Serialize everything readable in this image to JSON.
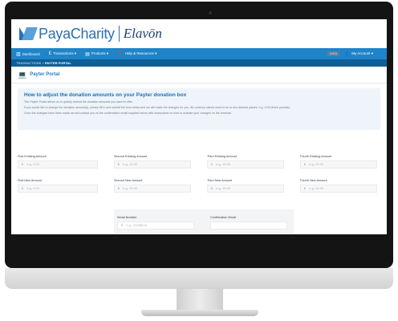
{
  "brand": {
    "paya": "PayaCharity",
    "elavon": "Elavōn"
  },
  "nav": {
    "items": [
      {
        "icon": "▥",
        "label": "Dashboard"
      },
      {
        "icon": "£",
        "label": "Transactions ▾"
      },
      {
        "icon": "▤",
        "label": "Products ▾"
      },
      {
        "icon": "❓",
        "label": "Help & Resources ▾"
      }
    ],
    "badge": "1.0.0",
    "account": "My Account ▾"
  },
  "breadcrumb": {
    "root": "TRANSACTIONS",
    "sep": ">",
    "current": "PAYTER PORTAL"
  },
  "portal": {
    "title": "Payter Portal"
  },
  "info": {
    "heading": "How to adjust the donation amounts on your Payter donation box",
    "p1": "The Payter Portal allows us to quickly amend the donation amounts you want to offer.",
    "p2": "If you would like to change the donation amount(s), please fill in and submit the form below and we will make the changes for you. All currency values need to be to two decimal places, e.g. 3.00 (three pounds).",
    "p3": "Once the changes have been made we will contact you on the confirmation email supplied below with instructions on how to activate your changes on the terminal."
  },
  "form": {
    "currency": "£",
    "existing": [
      {
        "label": "First Existing Amount",
        "placeholder": "e.g. 3.00"
      },
      {
        "label": "Second Existing Amount",
        "placeholder": "e.g. 10.00"
      },
      {
        "label": "Third Existing Amount",
        "placeholder": "e.g. 15.00"
      },
      {
        "label": "Fourth Existing Amount",
        "placeholder": "e.g. 20.00"
      }
    ],
    "new": [
      {
        "label": "First New Amount",
        "placeholder": "e.g. 3.00"
      },
      {
        "label": "Second New Amount",
        "placeholder": "e.g. 10.00"
      },
      {
        "label": "Third New Amount",
        "placeholder": "e.g. 15.00"
      },
      {
        "label": "Fourth New Amount",
        "placeholder": "e.g. 20.00"
      }
    ],
    "serial": {
      "label": "Serial Number",
      "placeholder": "e.g. 12345678"
    },
    "email": {
      "label": "Confirmation Email",
      "placeholder": ""
    }
  },
  "colors": {
    "primary": "#1f84c8",
    "breadcrumb_bg": "#0d5f98",
    "info_bg": "#eef4fa"
  }
}
